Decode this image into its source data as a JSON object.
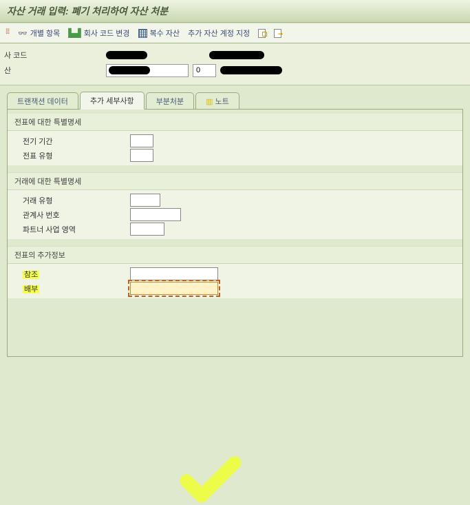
{
  "title": "자산 거래 입력: 폐기 처리하여 자산 처분",
  "toolbar": {
    "individual": "개별 항목",
    "company_code_change": "회사 코드 변경",
    "multi_asset": "복수 자산",
    "add_asset_account": "추가 자산 계정 지정"
  },
  "header": {
    "company_code_label": "사 코드",
    "asset_label": "산",
    "asset_sub_value": "0"
  },
  "tabs": {
    "t1": "트랜잭션 데이터",
    "t2": "추가 세부사항",
    "t3": "부분처분",
    "t4": "노트"
  },
  "groups": {
    "g1_title": "전표에 대한 특별명세",
    "g1_f1": "전기 기간",
    "g1_f2": "전표 유형",
    "g2_title": "거래에 대한 특별명세",
    "g2_f1": "거래 유형",
    "g2_f2": "관계사 번호",
    "g2_f3": "파트너 사업 영역",
    "g3_title": "전표의 추가정보",
    "g3_f1": "참조",
    "g3_f2": "배부"
  },
  "values": {
    "posting_period": "",
    "doc_type": "",
    "tx_type": "",
    "affiliate_no": "",
    "partner_biz": "",
    "reference": "",
    "assignment": ""
  }
}
